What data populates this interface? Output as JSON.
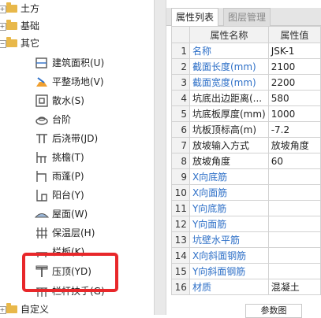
{
  "tree": {
    "top": [
      {
        "label": "土方",
        "expanded": false
      },
      {
        "label": "基础",
        "expanded": false
      },
      {
        "label": "其它",
        "expanded": true
      }
    ],
    "children": [
      {
        "label": "建筑面积(U)",
        "icon": "building-area-icon"
      },
      {
        "label": "平整场地(V)",
        "icon": "site-leveling-icon"
      },
      {
        "label": "散水(S)",
        "icon": "apron-icon"
      },
      {
        "label": "台阶",
        "icon": "steps-icon"
      },
      {
        "label": "后浇带(JD)",
        "icon": "post-cast-strip-icon"
      },
      {
        "label": "挑檐(T)",
        "icon": "cornice-icon"
      },
      {
        "label": "雨蓬(P)",
        "icon": "canopy-icon"
      },
      {
        "label": "阳台(Y)",
        "icon": "balcony-icon"
      },
      {
        "label": "屋面(W)",
        "icon": "roof-icon"
      },
      {
        "label": "保温层(H)",
        "icon": "insulation-icon"
      },
      {
        "label": "栏板(K)",
        "icon": "parapet-icon"
      },
      {
        "label": "压顶(YD)",
        "icon": "coping-icon"
      },
      {
        "label": "栏杆扶手(G)",
        "icon": "railing-icon"
      }
    ],
    "bottom": {
      "label": "自定义",
      "expanded": false
    }
  },
  "tabs": {
    "active": "属性列表",
    "inactive": "图层管理"
  },
  "table": {
    "header_name": "属性名称",
    "header_value": "属性值",
    "rows": [
      {
        "num": "1",
        "name": "名称",
        "value": "JSK-1",
        "blue": true
      },
      {
        "num": "2",
        "name": "截面长度(mm)",
        "value": "2100",
        "blue": true
      },
      {
        "num": "3",
        "name": "截面宽度(mm)",
        "value": "2200",
        "blue": true
      },
      {
        "num": "4",
        "name": "坑底出边距离(...",
        "value": "580",
        "blue": false
      },
      {
        "num": "5",
        "name": "坑底板厚度(mm)",
        "value": "1000",
        "blue": false
      },
      {
        "num": "6",
        "name": "坑板顶标高(m)",
        "value": "-7.2",
        "blue": false
      },
      {
        "num": "7",
        "name": "放坡输入方式",
        "value": "放坡角度",
        "blue": false
      },
      {
        "num": "8",
        "name": "放坡角度",
        "value": "60",
        "blue": false
      },
      {
        "num": "9",
        "name": "X向底筋",
        "value": "",
        "blue": true
      },
      {
        "num": "10",
        "name": "X向面筋",
        "value": "",
        "blue": true
      },
      {
        "num": "11",
        "name": "Y向底筋",
        "value": "",
        "blue": true
      },
      {
        "num": "12",
        "name": "Y向面筋",
        "value": "",
        "blue": true
      },
      {
        "num": "13",
        "name": "坑壁水平筋",
        "value": "",
        "blue": true
      },
      {
        "num": "14",
        "name": "X向斜面钢筋",
        "value": "",
        "blue": true
      },
      {
        "num": "15",
        "name": "Y向斜面钢筋",
        "value": "",
        "blue": true
      },
      {
        "num": "16",
        "name": "材质",
        "value": "混凝土",
        "blue": true
      }
    ]
  },
  "bottom_tab": "参数图",
  "colors": {
    "link_blue": "#2d6fc7",
    "highlight_red": "#e8272a",
    "folder": "#e8b84a"
  }
}
